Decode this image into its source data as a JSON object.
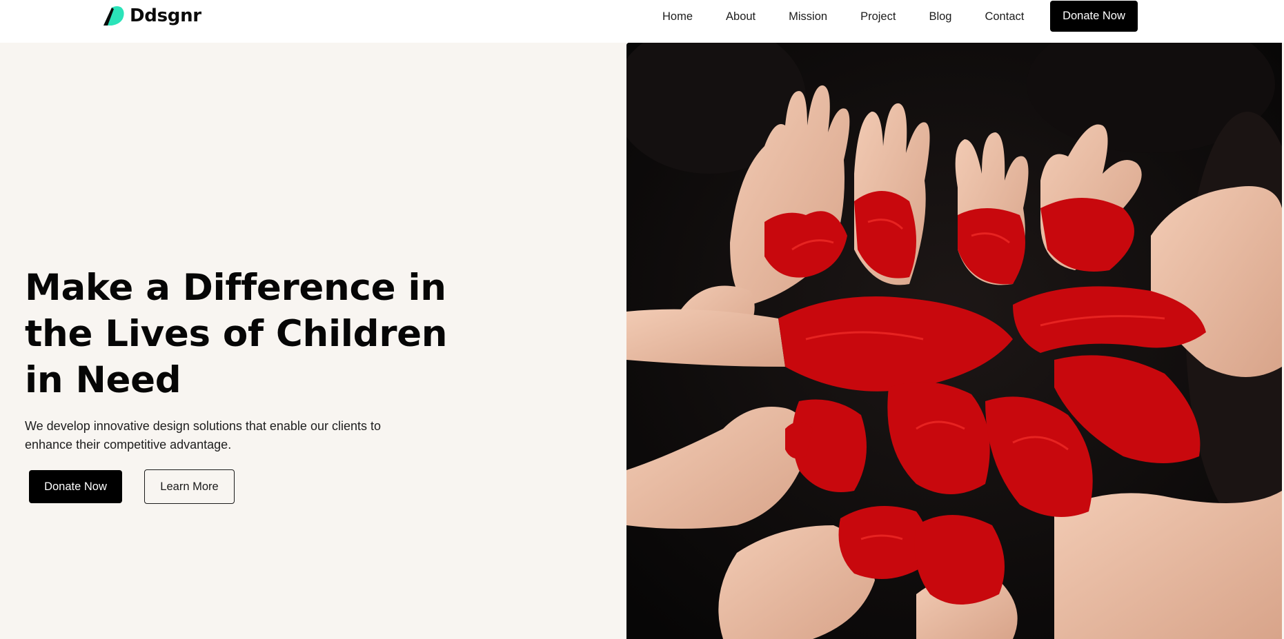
{
  "brand": {
    "name": "Ddsgnr",
    "icon": "leaf-logo-icon",
    "accent_color": "#2be3b9"
  },
  "nav": {
    "items": [
      {
        "label": "Home"
      },
      {
        "label": "About"
      },
      {
        "label": "Mission"
      },
      {
        "label": "Project"
      },
      {
        "label": "Blog"
      },
      {
        "label": "Contact"
      }
    ],
    "cta_label": "Donate Now"
  },
  "hero": {
    "title": "Make a Difference in the Lives of Children in Need",
    "subtitle": "We develop innovative design solutions that enable our clients to enhance their competitive advantage.",
    "primary_label": "Donate Now",
    "secondary_label": "Learn More",
    "image_subject": "red-painted-hands-photo"
  },
  "colors": {
    "background": "#f8f5f1",
    "button": "#000000",
    "paint_red": "#c8080d"
  }
}
